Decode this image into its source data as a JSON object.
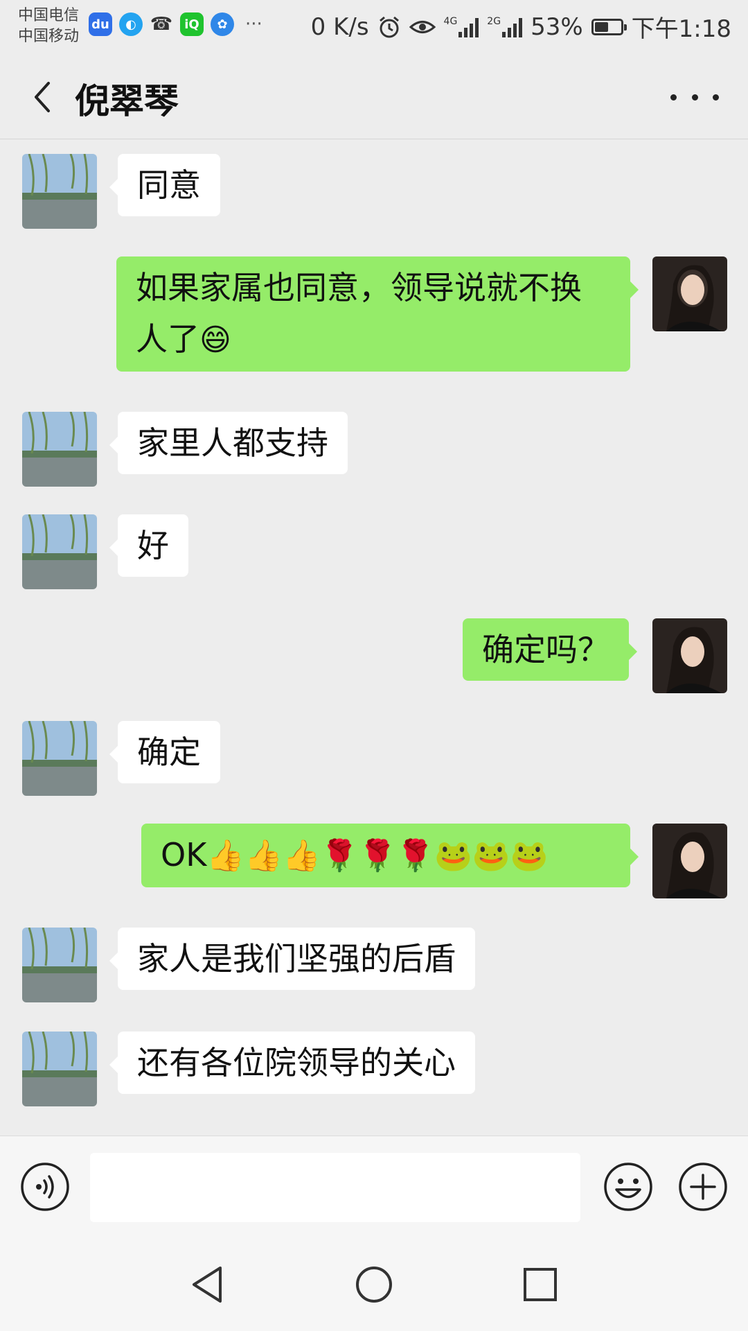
{
  "status_bar": {
    "carrier1": "中国电信",
    "carrier2": "中国移动",
    "net_speed": "0 K/s",
    "net1": "4G",
    "net2": "2G",
    "battery": "53%",
    "battery_level": 0.53,
    "time": "下午1:18",
    "app_icons": [
      "baidu-icon",
      "qq-browser-icon",
      "missed-call-icon",
      "iqiyi-icon",
      "app-icon",
      "more-icon"
    ],
    "more_glyph": "···"
  },
  "header": {
    "title": "倪翠琴"
  },
  "messages": [
    {
      "side": "left",
      "text": "同意"
    },
    {
      "side": "right",
      "line1": "如果家属也同意，领导说就不换",
      "line2": "人了",
      "emoji": "😄"
    },
    {
      "side": "left",
      "text": "家里人都支持"
    },
    {
      "side": "left",
      "text": "好"
    },
    {
      "side": "right",
      "text": "确定吗？"
    },
    {
      "side": "left",
      "text": "确定"
    },
    {
      "side": "right",
      "text": "OK",
      "emojis": "👍👍👍🌹🌹🌹🐸🐸🐸"
    },
    {
      "side": "left",
      "text": "家人是我们坚强的后盾"
    },
    {
      "side": "left",
      "text": "还有各位院领导的关心"
    }
  ],
  "colors": {
    "background": "#ededed",
    "bubble_self": "#95ec69",
    "bubble_other": "#ffffff"
  }
}
